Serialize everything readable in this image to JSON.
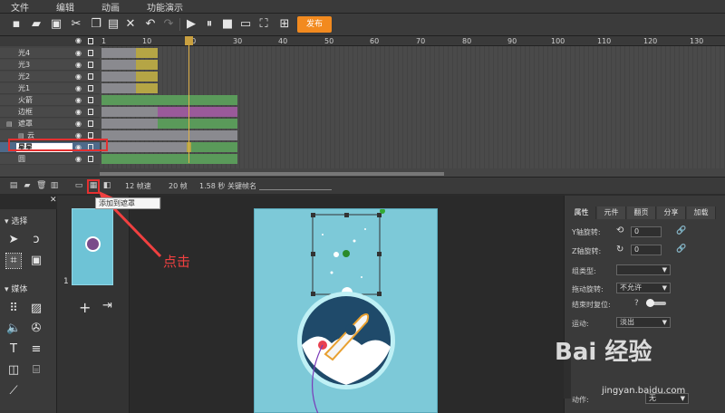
{
  "menubar": {
    "items": [
      "文件",
      "编辑",
      "动画",
      "功能演示"
    ]
  },
  "toolbar": {
    "publish_label": "发布"
  },
  "timeline": {
    "ruler_ticks": [
      "1",
      "10",
      "20",
      "30",
      "40",
      "50",
      "60",
      "70",
      "80",
      "90",
      "100",
      "110",
      "120",
      "130"
    ],
    "layers": [
      "光4",
      "光3",
      "光2",
      "光1",
      "火箭",
      "边框",
      "遮罩",
      "云",
      "星星",
      "圆"
    ],
    "selected_layer": "星星"
  },
  "timeline_footer": {
    "fps": "12 帧速",
    "frames": "20 帧",
    "seconds": "1.58 秒",
    "keyframe_label": "关键帧名"
  },
  "tooltip": {
    "text": "添加到遮罩"
  },
  "tools": {
    "select_label": "选择",
    "media_label": "媒体"
  },
  "scenes": {
    "number": "1"
  },
  "stage": {
    "tab_label": "舞台"
  },
  "annotation": {
    "click_label": "点击"
  },
  "props": {
    "tabs": [
      "属性",
      "元件",
      "翻页",
      "分享",
      "加载"
    ],
    "y_rotate_label": "Y轴旋转:",
    "y_rotate_value": "0",
    "z_rotate_label": "Z轴旋转:",
    "z_rotate_value": "0",
    "group_type_label": "组类型:",
    "group_type_value": "",
    "drag_rotate_label": "拖动旋转:",
    "drag_rotate_value": "不允许",
    "reset_label": "结束时复位:",
    "motion_label": "运动:",
    "motion_value": "淡出",
    "action_label": "动作:",
    "action_value": "无"
  },
  "watermark": {
    "brand": "Bai 经验",
    "url": "jingyan.baidu.com"
  },
  "colors": {
    "accent": "#f28a1f",
    "highlight": "#e43030",
    "stage": "#7dc9d8"
  }
}
